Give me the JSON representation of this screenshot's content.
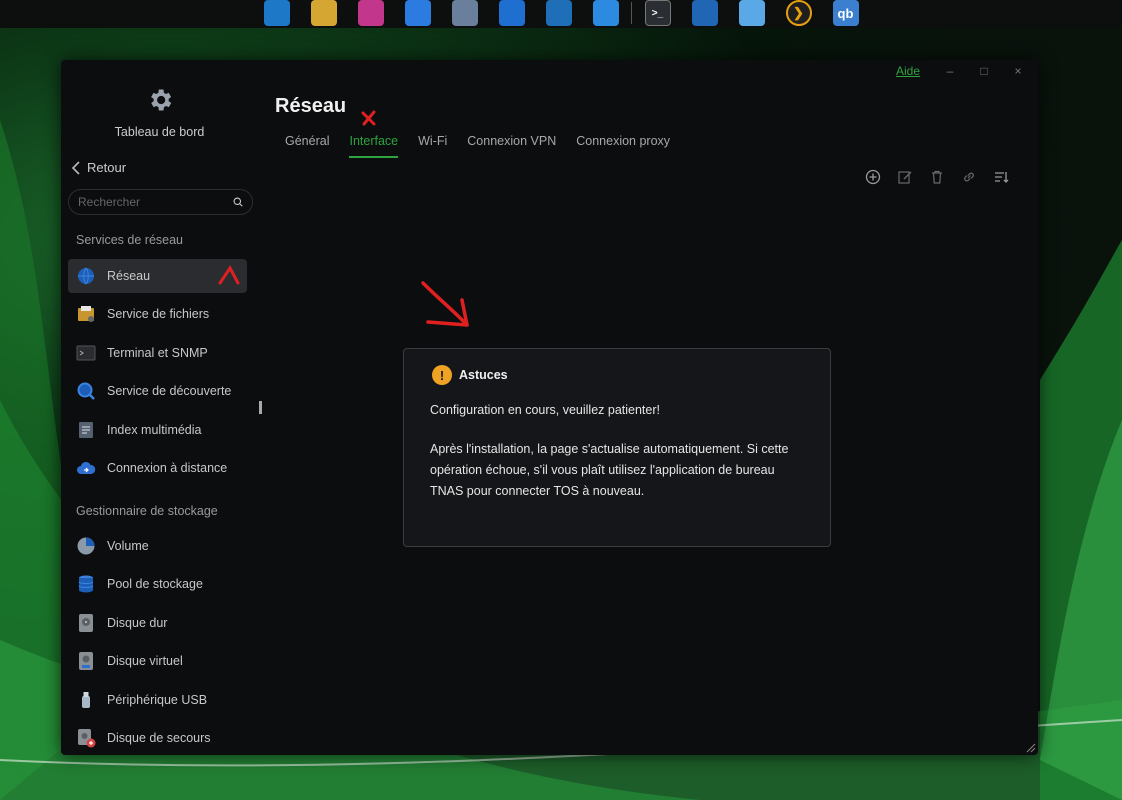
{
  "taskbar": {
    "icons": [
      {
        "name": "app-grid-icon",
        "color": "#1e78c8"
      },
      {
        "name": "file-manager-icon",
        "color": "#d6a632"
      },
      {
        "name": "app-center-icon",
        "color": "#c2368c"
      },
      {
        "name": "backup-clock-icon",
        "color": "#2c7be0"
      },
      {
        "name": "settings-gear-icon",
        "color": "#6a7f9c"
      },
      {
        "name": "store-bag-icon",
        "color": "#1f6fd1"
      },
      {
        "name": "docker-icon",
        "color": "#1e6fb8"
      },
      {
        "name": "support-headset-icon",
        "color": "#2c8be0"
      },
      {
        "name": "terminal-icon",
        "color": "#2a2e33"
      },
      {
        "name": "network-hub-icon",
        "color": "#2066b5"
      },
      {
        "name": "cloud-sync-icon",
        "color": "#5aa9e6"
      },
      {
        "name": "plex-icon",
        "color": "#1e1e1e"
      },
      {
        "name": "qbittorrent-icon",
        "color": "#3b7fd0"
      }
    ],
    "qb_label": "qb",
    "terminal_label": ">_"
  },
  "window": {
    "help_label": "Aide",
    "minimize_label": "–",
    "maximize_label": "□",
    "close_label": "×"
  },
  "sidebar": {
    "dashboard_label": "Tableau de bord",
    "back_label": "Retour",
    "search_placeholder": "Rechercher",
    "section_network": "Services de réseau",
    "network_items": [
      {
        "label": "Réseau",
        "icon": "globe-icon",
        "active": true
      },
      {
        "label": "Service de fichiers",
        "icon": "file-service-icon"
      },
      {
        "label": "Terminal et SNMP",
        "icon": "terminal-icon"
      },
      {
        "label": "Service de découverte",
        "icon": "discovery-search-icon"
      },
      {
        "label": "Index multimédia",
        "icon": "media-index-icon"
      },
      {
        "label": "Connexion à distance",
        "icon": "remote-cloud-icon"
      }
    ],
    "section_storage": "Gestionnaire de stockage",
    "storage_items": [
      {
        "label": "Volume",
        "icon": "volume-pie-icon"
      },
      {
        "label": "Pool de stockage",
        "icon": "storage-pool-icon"
      },
      {
        "label": "Disque dur",
        "icon": "hard-disk-icon"
      },
      {
        "label": "Disque virtuel",
        "icon": "virtual-disk-icon"
      },
      {
        "label": "Périphérique USB",
        "icon": "usb-device-icon"
      },
      {
        "label": "Disque de secours",
        "icon": "spare-disk-icon"
      }
    ]
  },
  "main": {
    "title": "Réseau",
    "tabs": [
      {
        "label": "Général"
      },
      {
        "label": "Interface",
        "active": true
      },
      {
        "label": "Wi-Fi"
      },
      {
        "label": "Connexion VPN"
      },
      {
        "label": "Connexion proxy"
      }
    ],
    "toolbar": [
      "add-icon",
      "edit-icon",
      "delete-icon",
      "link-icon",
      "sort-icon"
    ]
  },
  "tip": {
    "title": "Astuces",
    "icon_glyph": "!",
    "line1": "Configuration en cours, veuillez patienter!",
    "line2": "Après l'installation, la page s'actualise automatiquement. Si cette opération échoue, s'il vous plaît utilisez l'application de bureau TNAS pour connecter TOS à nouveau."
  },
  "colors": {
    "accent": "#2fa33f",
    "warning": "#f0a224",
    "annotation": "#e02020"
  }
}
